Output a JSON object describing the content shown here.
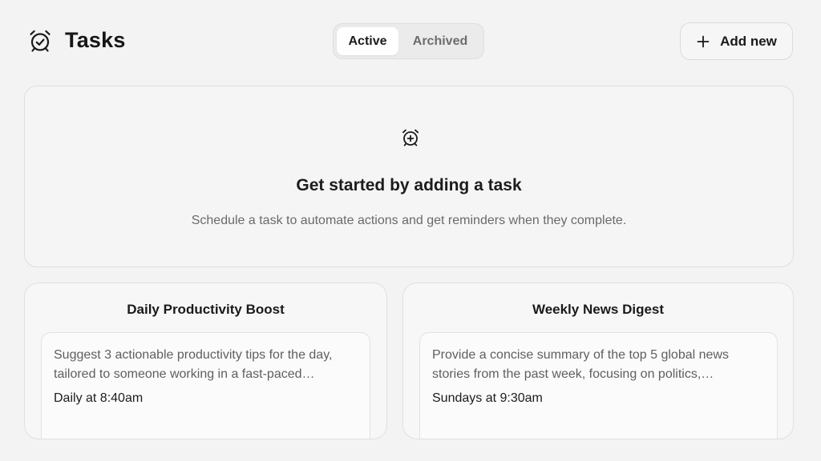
{
  "header": {
    "title": "Tasks",
    "icon": "alarm-clock-check-icon"
  },
  "tabs": [
    {
      "label": "Active",
      "selected": true
    },
    {
      "label": "Archived",
      "selected": false
    }
  ],
  "actions": {
    "add_label": "Add new",
    "add_icon": "plus-icon"
  },
  "empty_state": {
    "icon": "alarm-clock-plus-icon",
    "title": "Get started by adding a task",
    "subtitle": "Schedule a task to automate actions and get reminders when they complete."
  },
  "tasks": [
    {
      "title": "Daily Productivity Boost",
      "description": "Suggest 3 actionable productivity tips for the day, tailored to someone working in a fast-paced…",
      "schedule": "Daily at 8:40am"
    },
    {
      "title": "Weekly News Digest",
      "description": "Provide a concise summary of the top 5 global news stories from the past week, focusing on politics,…",
      "schedule": "Sundays at 9:30am"
    }
  ],
  "colors": {
    "background": "#f3f3f3",
    "text_primary": "#1a1a1a",
    "text_secondary": "#6a6a6a"
  }
}
